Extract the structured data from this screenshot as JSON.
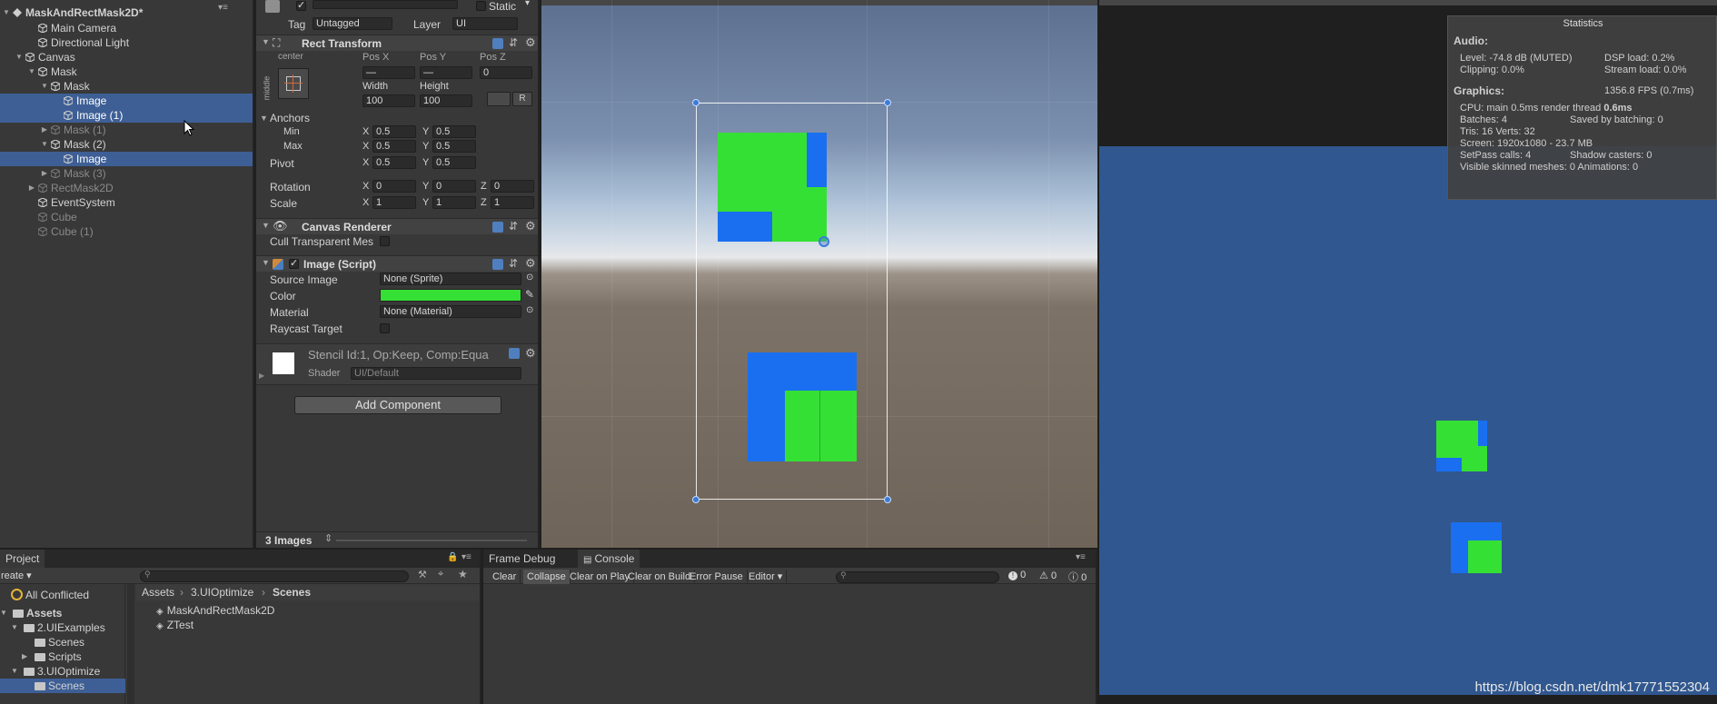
{
  "hierarchy": {
    "menu_glyph": "▾≡",
    "items": [
      {
        "label": "MaskAndRectMask2D*",
        "state": "scene"
      },
      {
        "label": "Main Camera",
        "state": "normal"
      },
      {
        "label": "Directional Light",
        "state": "normal"
      },
      {
        "label": "Canvas",
        "state": "normal"
      },
      {
        "label": "Mask",
        "state": "normal"
      },
      {
        "label": "Mask",
        "state": "normal"
      },
      {
        "label": "Image",
        "state": "selected"
      },
      {
        "label": "Image (1)",
        "state": "selected"
      },
      {
        "label": "Mask (1)",
        "state": "inactive"
      },
      {
        "label": "Mask (2)",
        "state": "normal"
      },
      {
        "label": "Image",
        "state": "selected"
      },
      {
        "label": "Mask (3)",
        "state": "inactive"
      },
      {
        "label": "RectMask2D",
        "state": "inactive"
      },
      {
        "label": "EventSystem",
        "state": "normal"
      },
      {
        "label": "Cube",
        "state": "inactive"
      },
      {
        "label": "Cube (1)",
        "state": "inactive"
      }
    ]
  },
  "inspector": {
    "static_label": "Static",
    "tag_label": "Tag",
    "tag_value": "Untagged",
    "layer_label": "Layer",
    "layer_value": "UI",
    "rect_transform": {
      "title": "Rect Transform",
      "anchor_h": "center",
      "anchor_v": "middle",
      "pos_x_label": "Pos X",
      "pos_y_label": "Pos Y",
      "pos_z_label": "Pos Z",
      "pos_x": "—",
      "pos_y": "—",
      "pos_z": "0",
      "width_label": "Width",
      "height_label": "Height",
      "width": "100",
      "height": "100",
      "r_button": "R",
      "anchors_label": "Anchors",
      "min_label": "Min",
      "max_label": "Max",
      "pivot_label": "Pivot",
      "rotation_label": "Rotation",
      "scale_label": "Scale",
      "x": "X",
      "y": "Y",
      "z": "Z",
      "min_x": "0.5",
      "min_y": "0.5",
      "max_x": "0.5",
      "max_y": "0.5",
      "pivot_x": "0.5",
      "pivot_y": "0.5",
      "rot_x": "0",
      "rot_y": "0",
      "rot_z": "0",
      "scale_x": "1",
      "scale_y": "1",
      "scale_z": "1"
    },
    "canvas_renderer": {
      "title": "Canvas Renderer",
      "cull_label": "Cull Transparent Mes"
    },
    "image_script": {
      "title": "Image (Script)",
      "source_image_label": "Source Image",
      "source_image_value": "None (Sprite)",
      "color_label": "Color",
      "color_value": "#35e035",
      "material_label": "Material",
      "material_value": "None (Material)",
      "raycast_label": "Raycast Target"
    },
    "material_preview": {
      "title": "Stencil Id:1, Op:Keep, Comp:Equa",
      "shader_label": "Shader",
      "shader_value": "UI/Default"
    },
    "add_component": "Add Component",
    "footer": "3 Images"
  },
  "stats": {
    "title": "Statistics",
    "audio_header": "Audio:",
    "level": "Level: -74.8 dB (MUTED)",
    "dsp": "DSP load: 0.2%",
    "clipping": "Clipping: 0.0%",
    "stream": "Stream load: 0.0%",
    "graphics_header": "Graphics:",
    "fps": "1356.8 FPS (0.7ms)",
    "cpu": "CPU: main 0.5ms  render thread ",
    "cpu_bold": "0.6ms",
    "batches": "Batches: 4",
    "saved": "Saved by batching: 0",
    "tris": "Tris: 16   Verts: 32",
    "screen": "Screen: 1920x1080 - 23.7 MB",
    "setpass": "SetPass calls: 4",
    "shadow": "Shadow casters: 0",
    "skinned": "Visible skinned meshes: 0  Animations: 0"
  },
  "game": {
    "watermark": "https://blog.csdn.net/dmk17771552304"
  },
  "project": {
    "tab": "Project",
    "create": "reate",
    "all_conflicted": "All Conflicted",
    "tree": [
      {
        "label": "Assets",
        "bold": true
      },
      {
        "label": "2.UIExamples",
        "bold": false
      },
      {
        "label": "Scenes",
        "bold": false
      },
      {
        "label": "Scripts",
        "bold": false
      },
      {
        "label": "3.UIOptimize",
        "bold": false
      },
      {
        "label": "Scenes",
        "bold": false
      }
    ],
    "breadcrumb": [
      "Assets",
      "3.UIOptimize",
      "Scenes"
    ],
    "files": [
      "MaskAndRectMask2D",
      "ZTest"
    ]
  },
  "console": {
    "tab_frame": "Frame Debug",
    "tab_console": "Console",
    "buttons": [
      "Clear",
      "Collapse",
      "Clear on Play",
      "Clear on Build",
      "Error Pause",
      "Editor ▾"
    ],
    "count_errors": "0",
    "count_warnings": "0",
    "count_logs": "0"
  }
}
